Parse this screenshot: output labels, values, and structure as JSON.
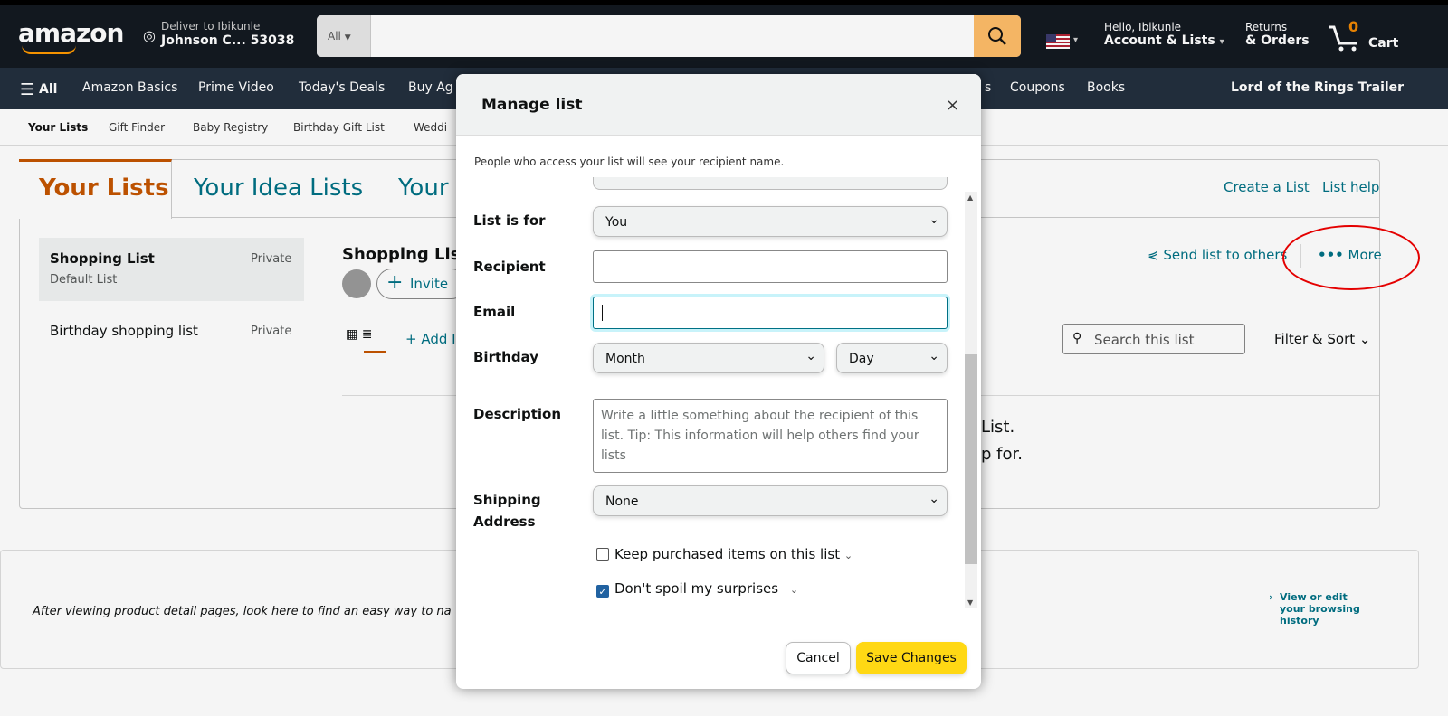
{
  "header": {
    "logo": "amazon",
    "deliver_line1": "Deliver to Ibikunle",
    "deliver_line2": "Johnson C... 53038",
    "search_category": "All",
    "search_placeholder": "",
    "hello_line1": "Hello, Ibikunle",
    "hello_line2": "Account & Lists",
    "returns_line1": "Returns",
    "returns_line2": "& Orders",
    "cart_count": "0",
    "cart_label": "Cart"
  },
  "navbar": {
    "all": "All",
    "items": [
      "Amazon Basics",
      "Prime Video",
      "Today's Deals",
      "Buy Ag",
      "s",
      "Coupons",
      "Books"
    ],
    "promo": "Lord of the Rings Trailer"
  },
  "subnav": {
    "items": [
      "Your Lists",
      "Gift Finder",
      "Baby Registry",
      "Birthday Gift List",
      "Weddi"
    ]
  },
  "page": {
    "tabs": [
      "Your Lists",
      "Your Idea Lists",
      "Your"
    ],
    "create_list": "Create a List",
    "list_help": "List help",
    "sidebar": [
      {
        "title": "Shopping List",
        "sub": "Default List",
        "privacy": "Private"
      },
      {
        "title": "Birthday shopping list",
        "privacy": "Private"
      }
    ],
    "list_title": "Shopping Lis",
    "invite": "Invite",
    "add_idea": "+ Add I",
    "send_list": "Send list to others",
    "more": "More",
    "search_list_placeholder": "Search this list",
    "filter_sort": "Filter & Sort",
    "empty_line1": "List.",
    "empty_line2": "p for.",
    "history_text": "After viewing product detail pages, look here to find an easy way to na",
    "view_edit": "View or edit your browsing history"
  },
  "modal": {
    "title": "Manage list",
    "close": "×",
    "note": "People who access your list will see your recipient name.",
    "fields": {
      "list_is_for_label": "List is for",
      "list_is_for_value": "You",
      "recipient_label": "Recipient",
      "recipient_value": "",
      "email_label": "Email",
      "email_value": "",
      "birthday_label": "Birthday",
      "month_value": "Month",
      "day_value": "Day",
      "description_label": "Description",
      "description_placeholder": "Write a little something about the recipient of this list. Tip: This information will help others find your lists",
      "shipping_label_1": "Shipping",
      "shipping_label_2": "Address",
      "shipping_value": "None"
    },
    "checkboxes": {
      "keep_purchased": "Keep purchased items on this list",
      "keep_purchased_checked": false,
      "dont_spoil": "Don't spoil my surprises",
      "dont_spoil_checked": true
    },
    "cancel": "Cancel",
    "save": "Save Changes"
  },
  "colors": {
    "header_bg": "#131921",
    "nav_bg": "#232f3e",
    "accent": "#ff9900",
    "link": "#007185",
    "active_tab": "#c45500",
    "save_button": "#ffd814",
    "annotation": "#e00000"
  }
}
